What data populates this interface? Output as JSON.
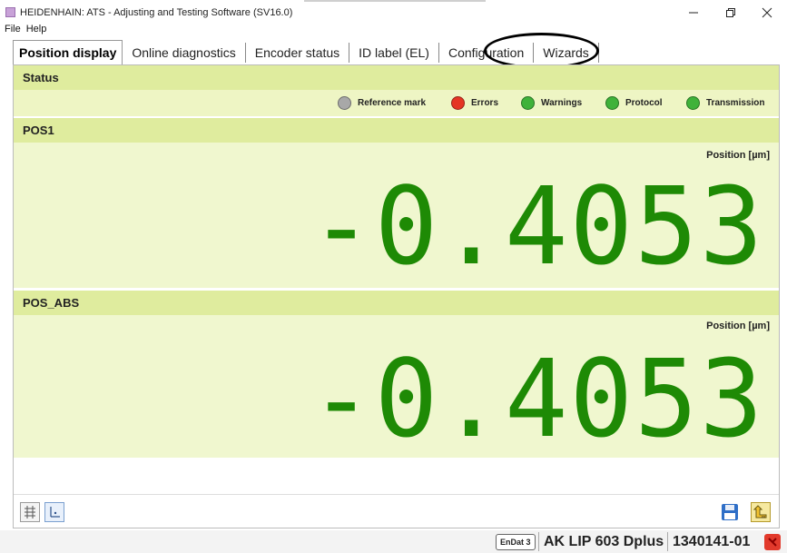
{
  "window": {
    "title": "HEIDENHAIN: ATS - Adjusting and Testing Software (SV16.0)",
    "controls": [
      "minimize",
      "restore",
      "close"
    ]
  },
  "menu": [
    "File",
    "Help"
  ],
  "tabs": [
    {
      "label": "Position display",
      "active": true
    },
    {
      "label": "Online diagnostics",
      "active": false
    },
    {
      "label": "Encoder status",
      "active": false
    },
    {
      "label": "ID label (EL)",
      "active": false
    },
    {
      "label": "Configuration",
      "active": false
    },
    {
      "label": "Wizards",
      "active": false
    }
  ],
  "status": {
    "title": "Status",
    "indicators": [
      {
        "label": "Reference mark",
        "color": "#a8a8a8"
      },
      {
        "label": "Errors",
        "color": "#e53524"
      },
      {
        "label": "Warnings",
        "color": "#3fb23a"
      },
      {
        "label": "Protocol",
        "color": "#3fb23a"
      },
      {
        "label": "Transmission",
        "color": "#3fb23a"
      }
    ]
  },
  "positions": [
    {
      "title": "POS1",
      "unit": "Position [µm]",
      "value": "-0.4053"
    },
    {
      "title": "POS_ABS",
      "unit": "Position [µm]",
      "value": "-0.4053"
    }
  ],
  "toolbar": {
    "icons": [
      "grid-icon",
      "axis-icon",
      "save-icon",
      "export-icon"
    ]
  },
  "statusbar": {
    "interface": "EnDat 3",
    "model": "AK LIP 603 Dplus",
    "serial": "1340141-01",
    "status_color": "#e23a2c"
  },
  "colors": {
    "header": "#dfec9e",
    "panel": "#f0f7cf",
    "digits": "#1e8a05"
  }
}
